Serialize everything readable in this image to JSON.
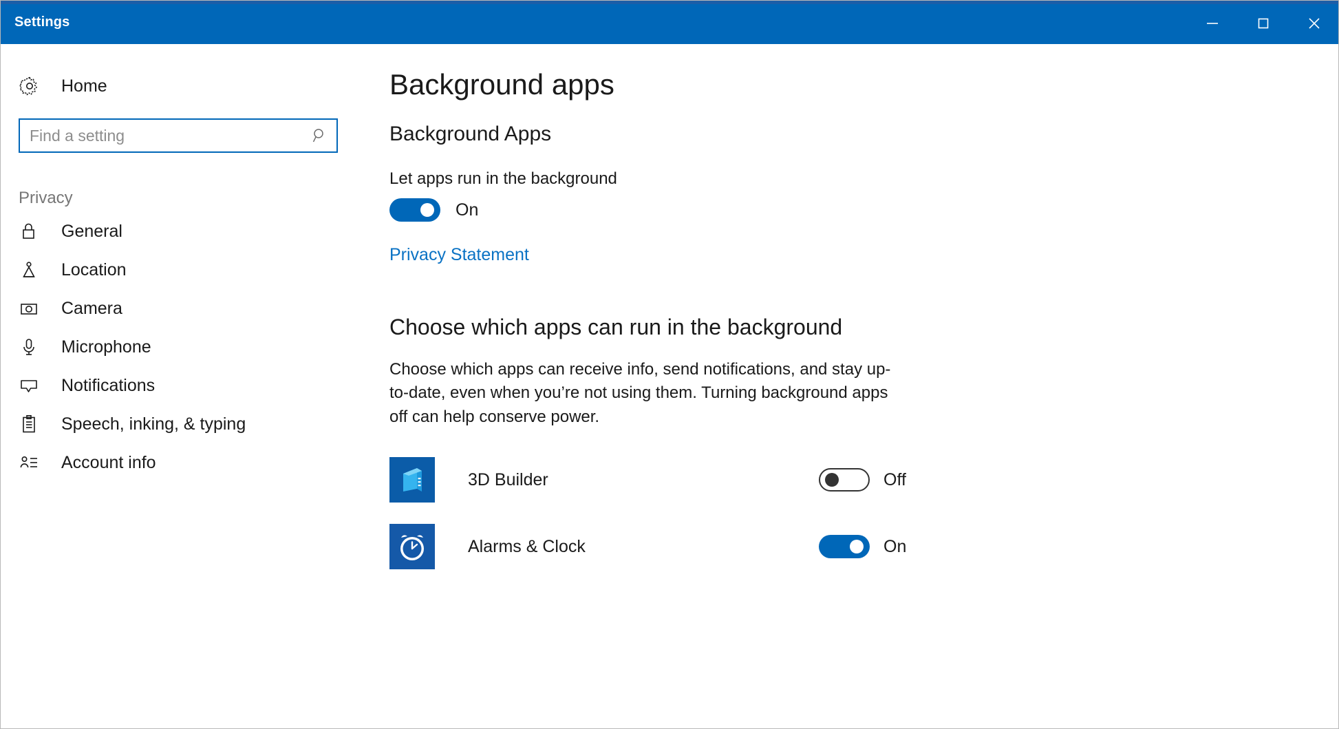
{
  "window": {
    "title": "Settings",
    "controls": [
      {
        "name": "minimize",
        "glyph": "minimize-icon"
      },
      {
        "name": "maximize",
        "glyph": "maximize-icon"
      },
      {
        "name": "close",
        "glyph": "close-icon"
      }
    ]
  },
  "sidebar": {
    "home": {
      "label": "Home",
      "icon": "gear-icon"
    },
    "search": {
      "value": "",
      "placeholder": "Find a setting",
      "icon": "search-icon"
    },
    "section_label": "Privacy",
    "items": [
      {
        "label": "General",
        "icon": "lock-icon"
      },
      {
        "label": "Location",
        "icon": "location-pin-icon"
      },
      {
        "label": "Camera",
        "icon": "camera-icon"
      },
      {
        "label": "Microphone",
        "icon": "microphone-icon"
      },
      {
        "label": "Notifications",
        "icon": "notification-balloon-icon"
      },
      {
        "label": "Speech, inking, & typing",
        "icon": "clipboard-icon"
      },
      {
        "label": "Account info",
        "icon": "account-info-icon"
      }
    ]
  },
  "main": {
    "page_title": "Background apps",
    "sub_heading": "Background Apps",
    "master_toggle": {
      "label": "Let apps run in the background",
      "state": "On",
      "on": true
    },
    "privacy_link": "Privacy Statement",
    "section_heading": "Choose which apps can run in the background",
    "paragraph": "Choose which apps can receive info, send notifications, and stay up-to-date, even when you’re not using them. Turning background apps off can help conserve power.",
    "apps": [
      {
        "name": "3D Builder",
        "icon": "3d-builder-icon",
        "state": "Off",
        "on": false
      },
      {
        "name": "Alarms & Clock",
        "icon": "alarms-clock-icon",
        "state": "On",
        "on": true
      }
    ]
  },
  "colors": {
    "accent": "#0067b8",
    "titlebar": "#0067b8",
    "link": "#0a72c4",
    "muted_text": "#767676"
  }
}
